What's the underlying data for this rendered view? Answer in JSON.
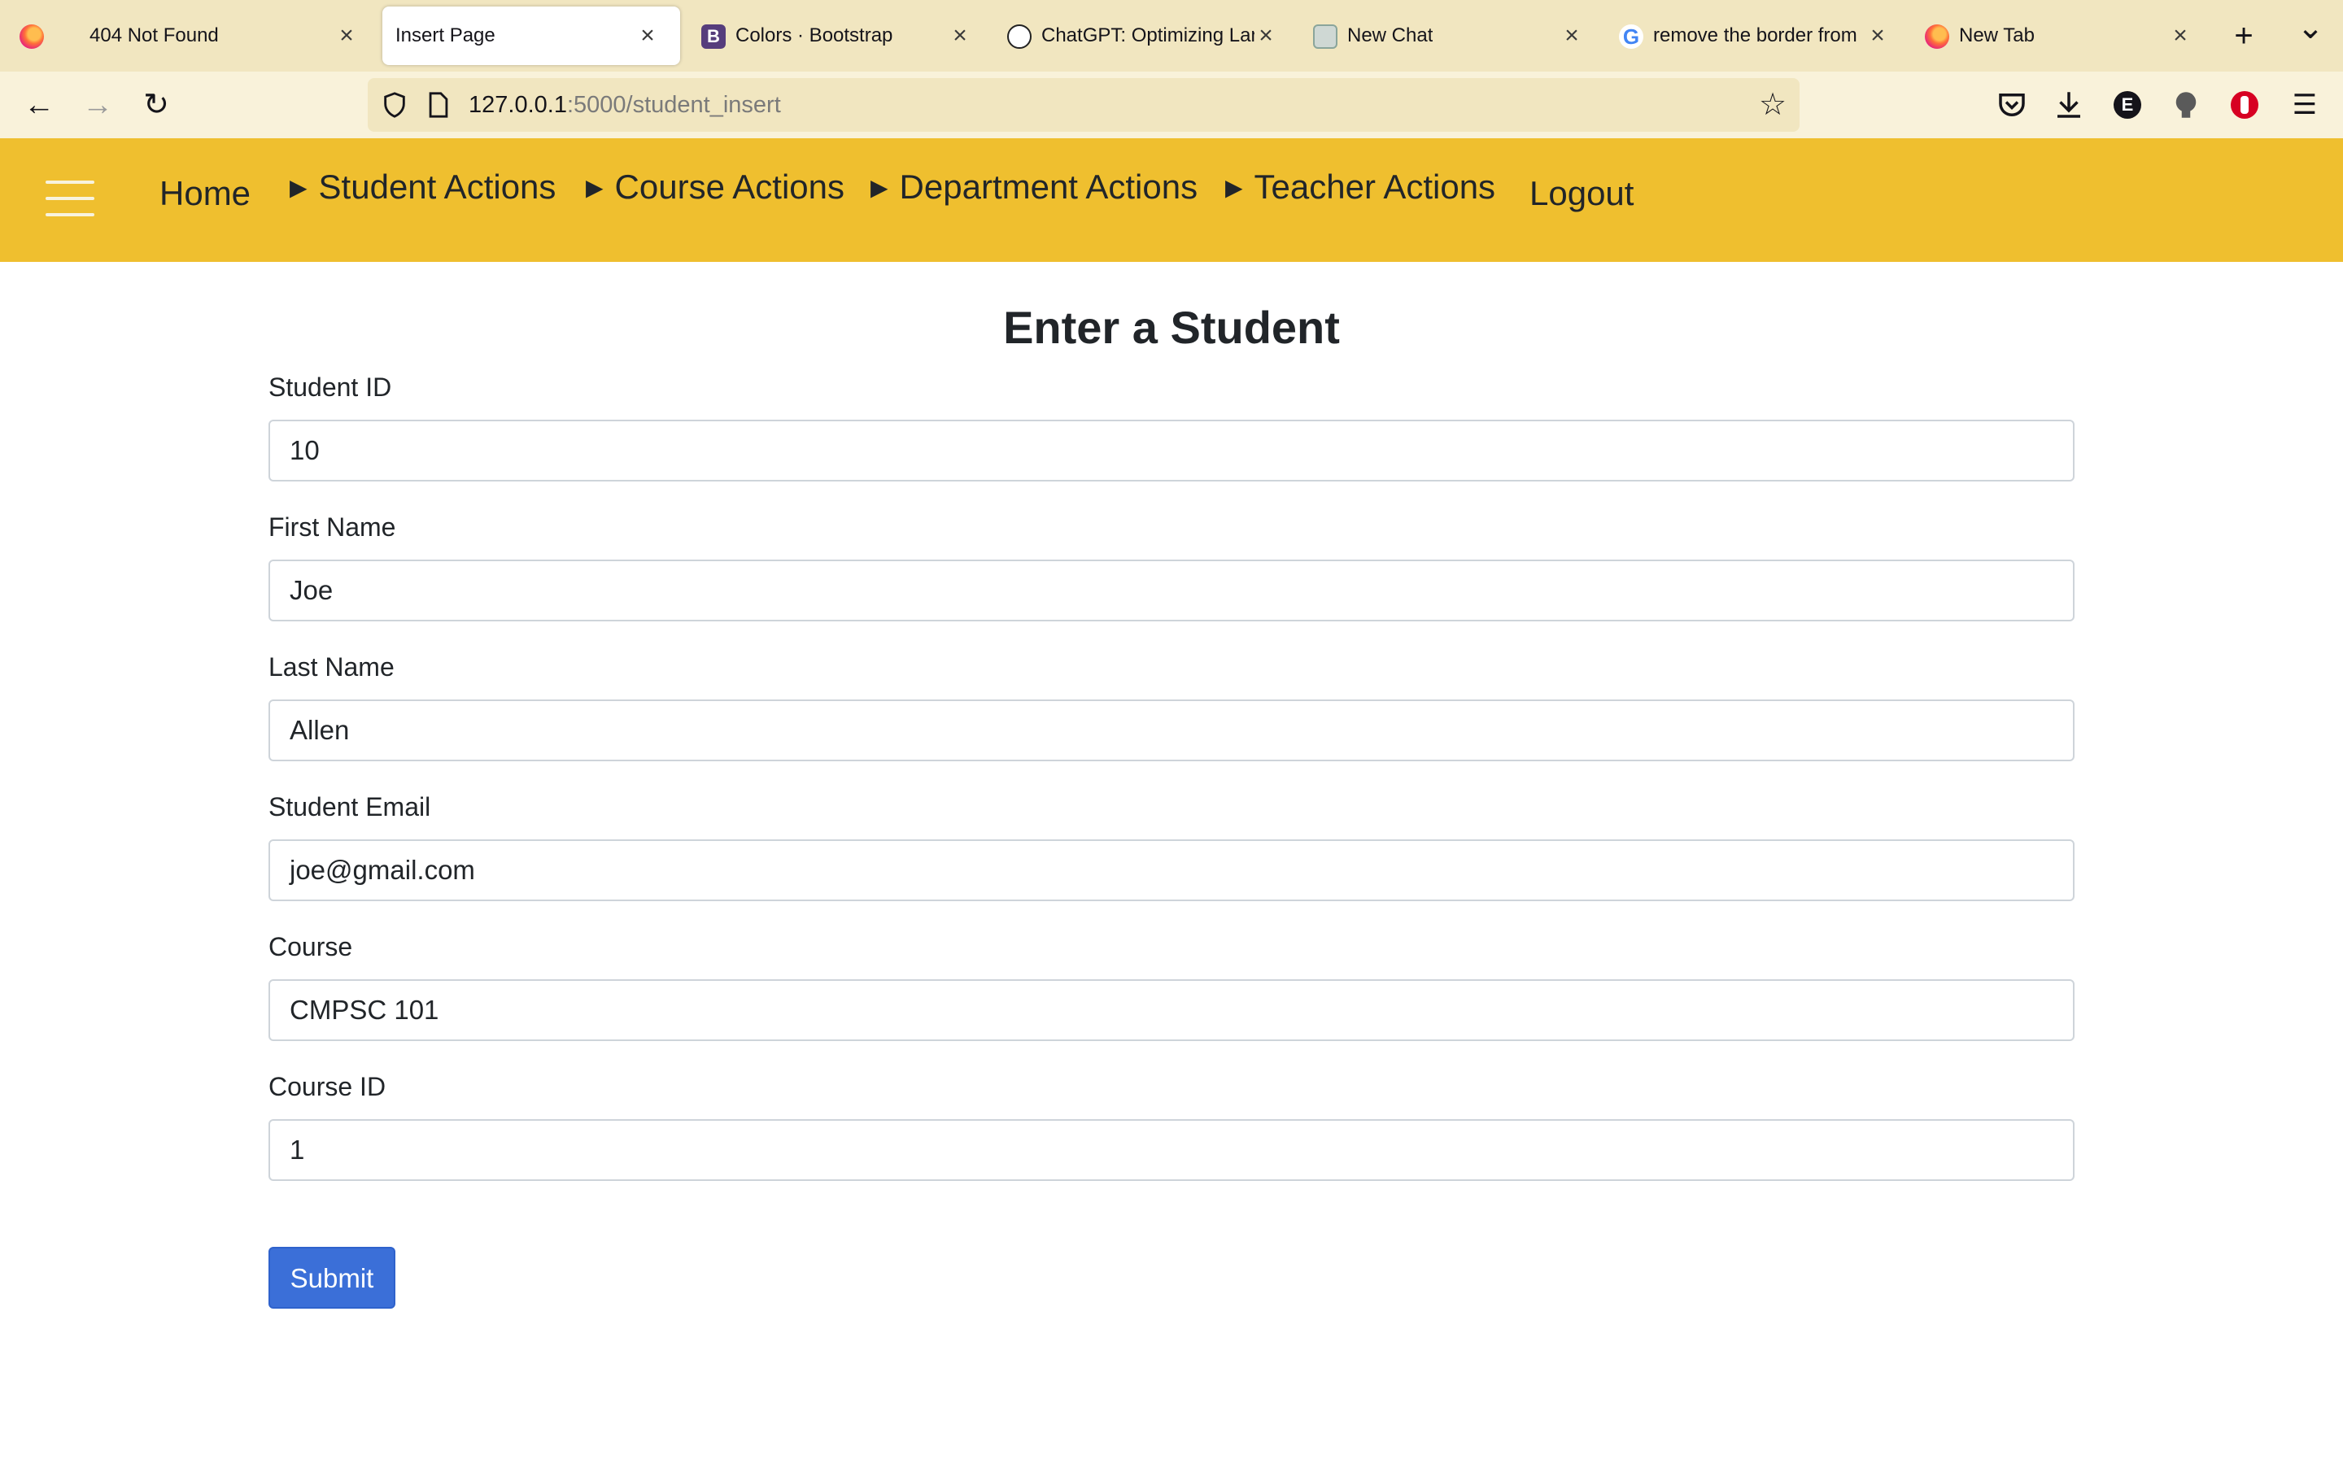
{
  "browser": {
    "tabs": [
      {
        "label": "404 Not Found",
        "icon": "firefox-icon"
      },
      {
        "label": "Insert Page",
        "icon": "none",
        "active": true
      },
      {
        "label": "Colors · Bootstrap",
        "icon": "bootstrap-icon"
      },
      {
        "label": "ChatGPT: Optimizing Lan",
        "icon": "openai-icon"
      },
      {
        "label": "New Chat",
        "icon": "openai-icon"
      },
      {
        "label": "remove the border from",
        "icon": "google-icon"
      },
      {
        "label": "New Tab",
        "icon": "firefox-icon"
      }
    ],
    "pinned_icon": "firefox-icon",
    "tab_close_glyph": "×",
    "new_tab_glyph": "+",
    "tab_list_glyph": "⌄",
    "url_host": "127.0.0.1",
    "url_path": ":5000/student_insert",
    "bootstrap_letter": "B",
    "google_letter": "G",
    "extension_letter": "E"
  },
  "site": {
    "nav": {
      "home": "Home",
      "student_actions": "Student Actions",
      "course_actions": "Course Actions",
      "department_actions": "Department Actions",
      "teacher_actions": "Teacher Actions",
      "logout": "Logout",
      "arrow": "▶"
    },
    "header_color": "#efbf2f"
  },
  "form": {
    "title": "Enter a Student",
    "fields": [
      {
        "label": "Student ID",
        "value": "10"
      },
      {
        "label": "First Name",
        "value": "Joe"
      },
      {
        "label": "Last Name",
        "value": "Allen"
      },
      {
        "label": "Student Email",
        "value": "joe@gmail.com"
      },
      {
        "label": "Course",
        "value": "CMPSC 101"
      },
      {
        "label": "Course ID",
        "value": "1"
      }
    ],
    "submit_label": "Submit",
    "submit_color": "#3b6fd8"
  }
}
